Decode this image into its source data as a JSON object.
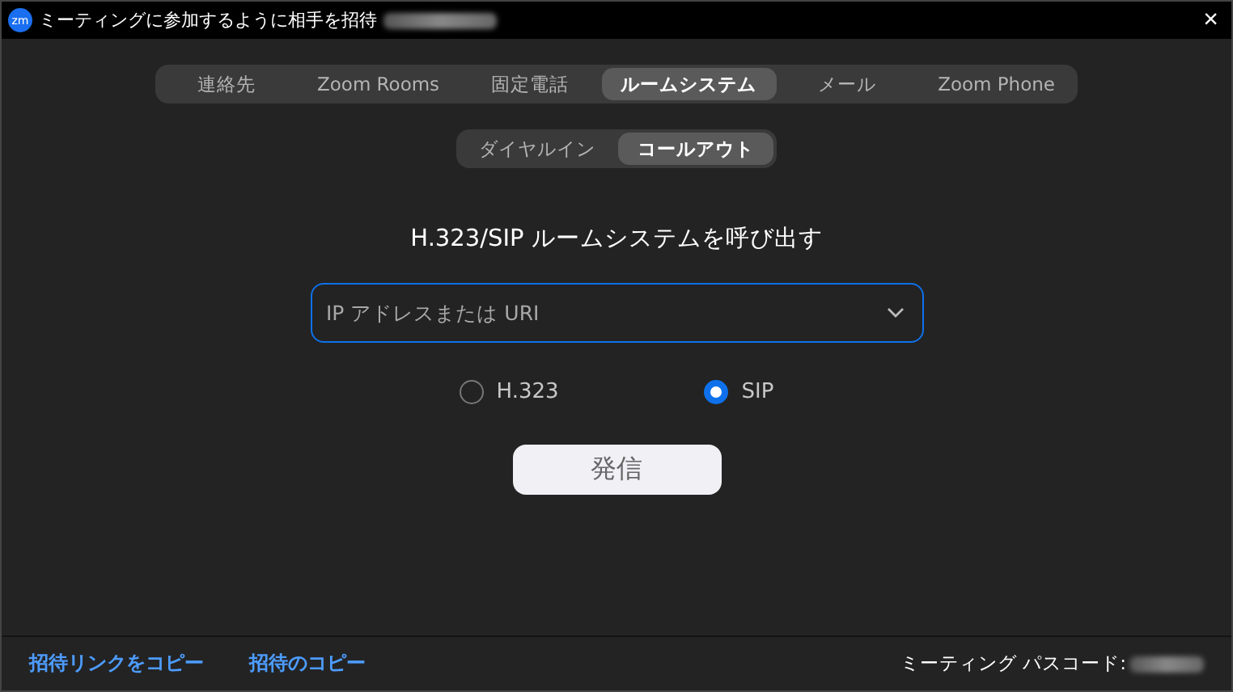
{
  "window": {
    "app_icon": "zm",
    "title": "ミーティングに参加するように相手を招待",
    "close": "×"
  },
  "tabs": [
    {
      "label": "連絡先",
      "selected": false
    },
    {
      "label": "Zoom Rooms",
      "selected": false
    },
    {
      "label": "固定電話",
      "selected": false
    },
    {
      "label": "ルームシステム",
      "selected": true
    },
    {
      "label": "メール",
      "selected": false
    },
    {
      "label": "Zoom Phone",
      "selected": false
    }
  ],
  "subtabs": [
    {
      "label": "ダイヤルイン",
      "selected": false
    },
    {
      "label": "コールアウト",
      "selected": true
    }
  ],
  "heading": "H.323/SIP ルームシステムを呼び出す",
  "address_field": {
    "placeholder": "IP アドレスまたは URI"
  },
  "protocols": [
    {
      "label": "H.323",
      "selected": false
    },
    {
      "label": "SIP",
      "selected": true
    }
  ],
  "call_button": "発信",
  "footer": {
    "links": [
      "招待リンクをコピー",
      "招待のコピー"
    ],
    "passcode_label": "ミーティング パスコード:"
  }
}
